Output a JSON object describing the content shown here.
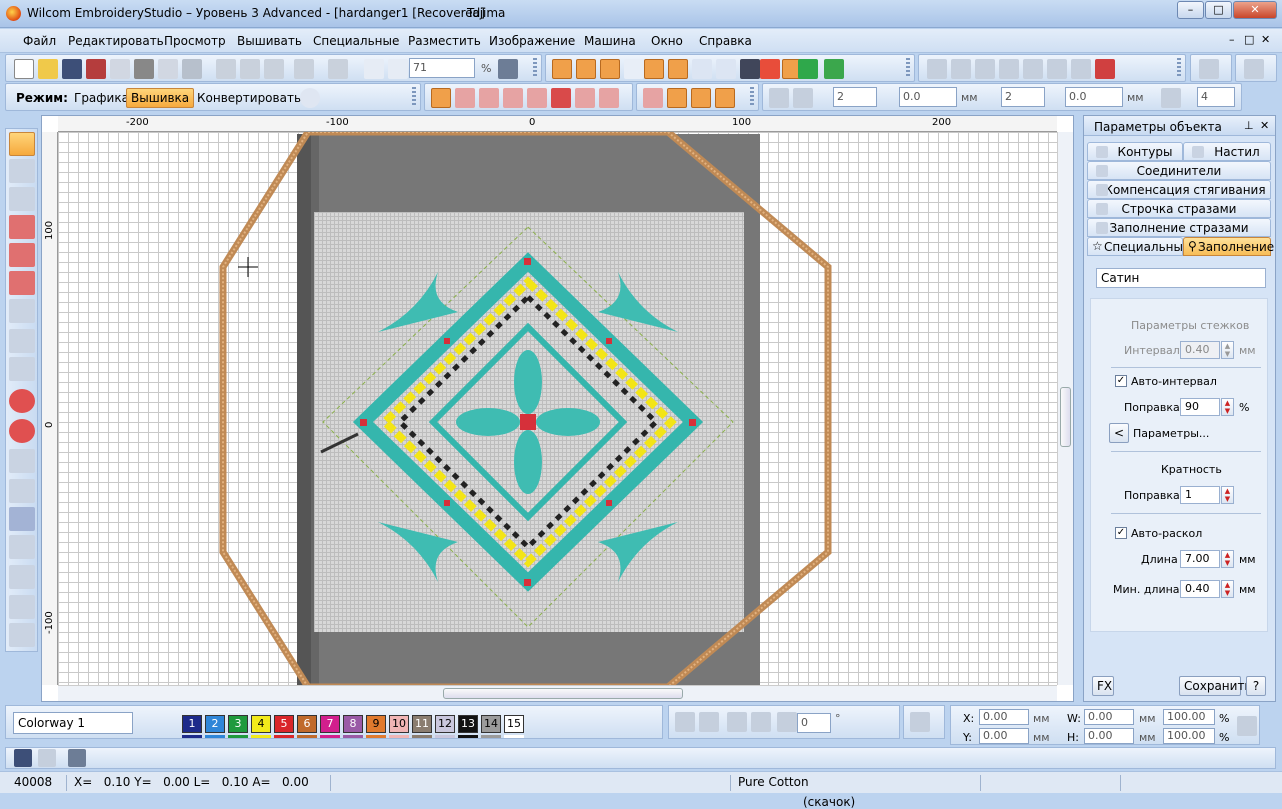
{
  "window": {
    "title": "Wilcom EmbroideryStudio – Уровень 3 Advanced - [hardanger1 [Recovered]",
    "machine": "Tajima",
    "controls": [
      "–",
      "□",
      "✕"
    ]
  },
  "menu": {
    "items": [
      "Файл",
      "Редактировать",
      "Просмотр",
      "Вышивать",
      "Специальные",
      "Разместить",
      "Изображение",
      "Машина",
      "Окно",
      "Справка"
    ],
    "mdi_controls": [
      "–",
      "□",
      "✕"
    ]
  },
  "toolbar": {
    "zoom_value": "71",
    "zoom_unit": "%"
  },
  "mode_bar": {
    "label": "Режим:",
    "buttons": [
      "Графика",
      "Вышивка",
      "Конвертировать"
    ],
    "active": "Вышивка"
  },
  "transform_bar": {
    "v1": "2",
    "v2": "0.0",
    "unit1": "мм",
    "v3": "2",
    "v4": "0.0",
    "unit2": "мм",
    "v5": "4"
  },
  "ruler": {
    "h_labels": [
      "-200",
      "-100",
      "0",
      "100",
      "200"
    ],
    "v_labels": [
      "100",
      "0",
      "-100"
    ]
  },
  "props": {
    "title": "Параметры объекта",
    "tabs": [
      "Контуры",
      "Настил",
      "Соединители",
      "Компенсация стягивания",
      "Строчка стразами",
      "Заполнение стразами",
      "Специальные",
      "Заполнение"
    ],
    "active_tab": "Заполнение",
    "fill_type": "Сатин",
    "stitch_params_title": "Параметры стежков",
    "interval_label": "Интервал",
    "interval_value": "0.40",
    "unit_mm": "мм",
    "auto_interval_label": "Авто-интервал",
    "auto_interval_checked": true,
    "correction_label": "Поправка",
    "correction_value": "90",
    "correction_unit": "%",
    "params_btn_arrow": "<",
    "params_btn_label": "Параметры...",
    "multiplicity_title": "Кратность",
    "mult_correction_label": "Поправка",
    "mult_correction_value": "1",
    "auto_split_label": "Авто-раскол",
    "auto_split_checked": true,
    "length_label": "Длина",
    "length_value": "7.00",
    "min_length_label": "Мин. длина",
    "min_length_value": "0.40",
    "fx_label": "FX",
    "save_label": "Сохранить",
    "help_label": "?"
  },
  "colorbar": {
    "colorway": "Colorway 1",
    "swatches": [
      {
        "n": "1",
        "bg": "#1d2a8a",
        "fg": "#ffffff"
      },
      {
        "n": "2",
        "bg": "#2f86d8",
        "fg": "#ffffff"
      },
      {
        "n": "3",
        "bg": "#1f9a3d",
        "fg": "#ffffff"
      },
      {
        "n": "4",
        "bg": "#f2ea1a",
        "fg": "#000000"
      },
      {
        "n": "5",
        "bg": "#d9262b",
        "fg": "#ffffff"
      },
      {
        "n": "6",
        "bg": "#c06a2b",
        "fg": "#ffffff"
      },
      {
        "n": "7",
        "bg": "#d21f8d",
        "fg": "#ffffff"
      },
      {
        "n": "8",
        "bg": "#9a5aa6",
        "fg": "#ffffff"
      },
      {
        "n": "9",
        "bg": "#e07a2e",
        "fg": "#000000"
      },
      {
        "n": "10",
        "bg": "#f1b5b5",
        "fg": "#000000"
      },
      {
        "n": "11",
        "bg": "#8a7d70",
        "fg": "#ffffff"
      },
      {
        "n": "12",
        "bg": "#c9c7dd",
        "fg": "#000000"
      },
      {
        "n": "13",
        "bg": "#111111",
        "fg": "#ffffff"
      },
      {
        "n": "14",
        "bg": "#9b9b9b",
        "fg": "#000000"
      },
      {
        "n": "15",
        "bg": "#ffffff",
        "fg": "#000000"
      }
    ],
    "angle_value": "0",
    "angle_unit": "°",
    "x_label": "X:",
    "x_value": "0.00",
    "y_label": "Y:",
    "y_value": "0.00",
    "w_label": "W:",
    "w_value": "0.00",
    "h_label": "H:",
    "h_value": "0.00",
    "pw_value": "100.00",
    "ph_value": "100.00",
    "unit_mm": "мм",
    "unit_pct": "%"
  },
  "status": {
    "stitch_count": "40008",
    "coords": "X=   0.10 Y=   0.00 L=   0.10 A=   0.00",
    "fabric": "Pure Cotton",
    "hint": "(скачок)"
  }
}
